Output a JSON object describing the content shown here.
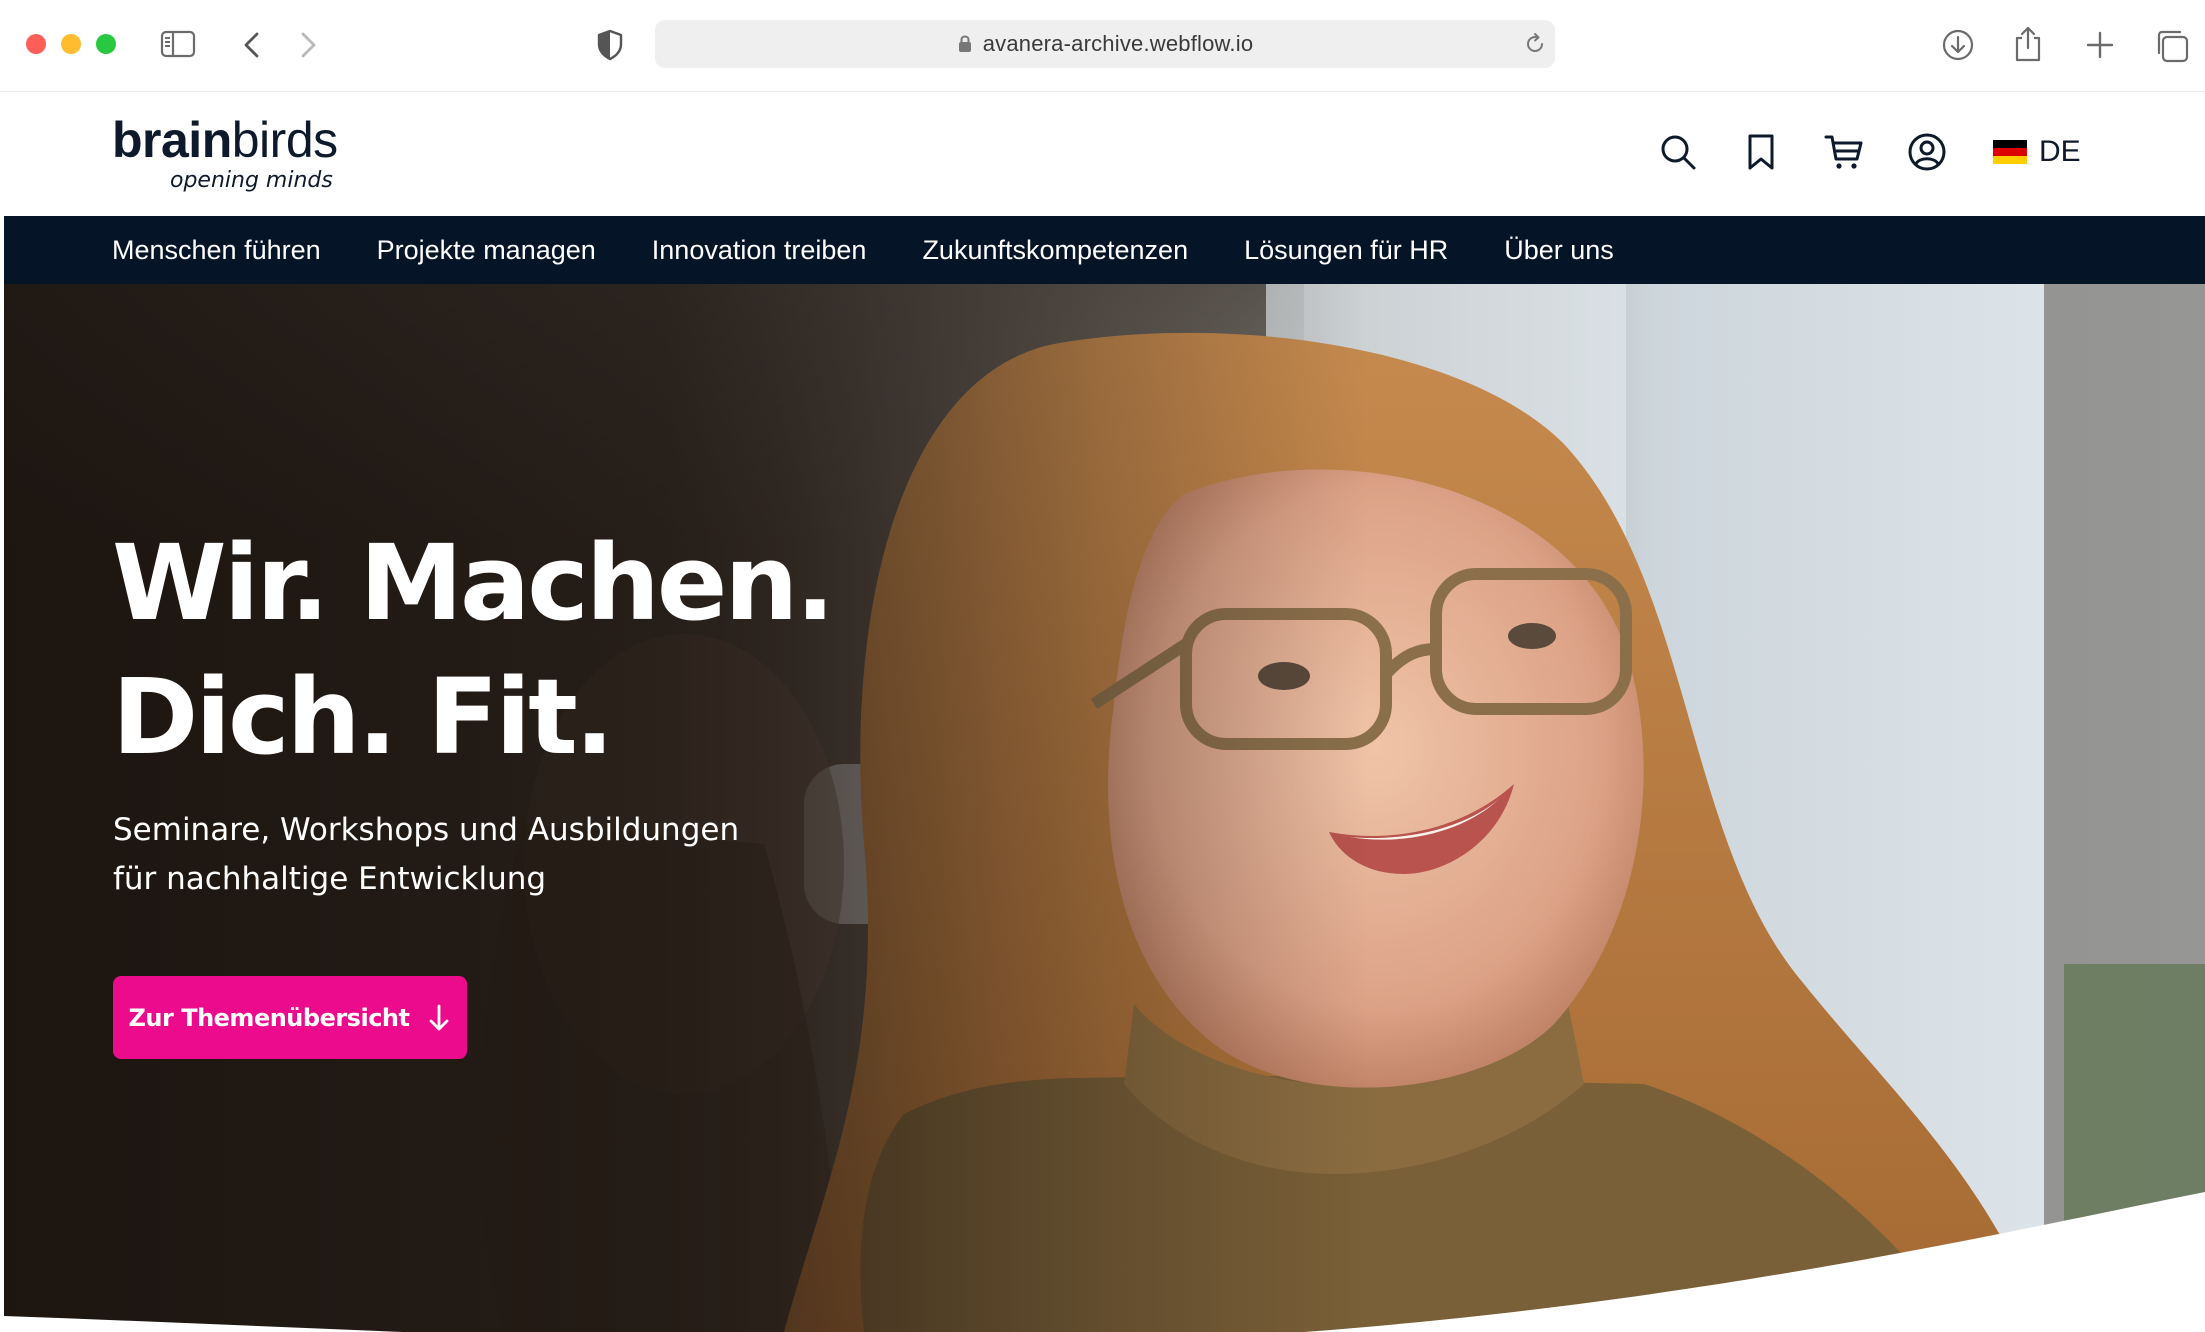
{
  "browser": {
    "url": "avanera-archive.webflow.io"
  },
  "site": {
    "logo": {
      "part1": "brain",
      "part2": "birds",
      "tagline": "opening minds"
    },
    "language": "DE"
  },
  "nav": {
    "items": [
      "Menschen führen",
      "Projekte managen",
      "Innovation treiben",
      "Zukunftskompetenzen",
      "Lösungen für HR",
      "Über uns"
    ]
  },
  "hero": {
    "title_line1": "Wir. Machen.",
    "title_line2": "Dich. Fit.",
    "subtitle_line1": "Seminare, Workshops und Ausbildungen",
    "subtitle_line2": "für nachhaltige Entwicklung",
    "cta_label": "Zur Themenübersicht"
  },
  "colors": {
    "nav_background": "#061428",
    "cta_background": "#ec0b8c",
    "text_dark": "#0e1a2b"
  },
  "icons": {
    "header": [
      "search-icon",
      "bookmark-icon",
      "cart-icon",
      "account-icon",
      "german-flag-icon"
    ],
    "cta": "arrow-down-icon"
  }
}
